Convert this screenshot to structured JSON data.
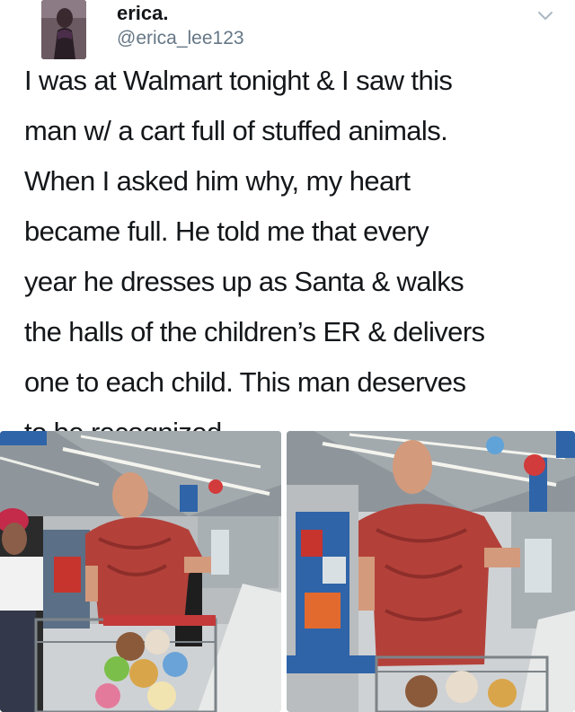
{
  "user": {
    "name": "erica.",
    "handle": "@erica_lee123"
  },
  "tweet": {
    "lines": [
      "I was at Walmart tonight & I saw this",
      "man w/ a cart full of stuffed animals.",
      "When I asked him why, my heart",
      "became full. He told me that every",
      "year he dresses up as Santa & walks",
      "the halls of the children’s ER & delivers",
      "one to each child. This man deserves",
      "to be recognized."
    ]
  },
  "icons": {
    "menu": "chevron-down-icon"
  },
  "colors": {
    "text": "#14171a",
    "handle": "#657786",
    "shirt": "#b3413a",
    "store_blue": "#2f64a8"
  }
}
